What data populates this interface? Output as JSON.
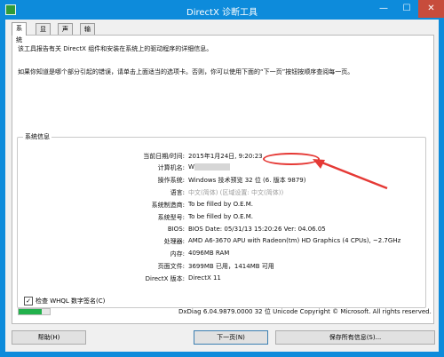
{
  "window": {
    "title": "DirectX 诊断工具",
    "min": "—",
    "max": "☐",
    "close": "✕"
  },
  "tabs": [
    {
      "label": "系统",
      "active": true
    },
    {
      "label": "显示",
      "active": false
    },
    {
      "label": "声音",
      "active": false
    },
    {
      "label": "输入",
      "active": false
    }
  ],
  "intro": {
    "line1": "该工具报告有关 DirectX 组件和安装在系统上的驱动程序的详细信息。",
    "line2": "如果你知道是哪个部分引起的错误，请单击上面适当的选项卡。否则，你可以使用下面的“下一页”按钮按顺序查阅每一页。"
  },
  "system_info": {
    "title": "系统信息",
    "rows": [
      {
        "label": "当前日期/时间:",
        "value": "2015年1月24日, 9:20:23"
      },
      {
        "label": "计算机名:",
        "value": "W"
      },
      {
        "label": "操作系统:",
        "value": "Windows 技术预览 32 位 (6.",
        "highlight": "版本 9879)"
      },
      {
        "label": "语言:",
        "value": "中文(简体) (区域设置: 中文(简体))"
      },
      {
        "label": "系统制造商:",
        "value": "To be filled by O.E.M."
      },
      {
        "label": "系统型号:",
        "value": "To be filled by O.E.M."
      },
      {
        "label": "BIOS:",
        "value": "BIOS Date: 05/31/13 15:20:26 Ver: 04.06.05"
      },
      {
        "label": "处理器:",
        "value": "AMD A6-3670 APU with Radeon(tm) HD Graphics (4 CPUs), ~2.7GHz"
      },
      {
        "label": "内存:",
        "value": "4096MB RAM"
      },
      {
        "label": "页面文件:",
        "value": "3699MB 已用，1414MB 可用"
      },
      {
        "label": "DirectX 版本:",
        "value": "DirectX 11"
      }
    ]
  },
  "whql": {
    "label": "检查 WHQL 数字签名(C)",
    "checked": true,
    "mark": "✓"
  },
  "progress": {
    "fraction": 0.75,
    "color": "#22b14c"
  },
  "footer_info": "DxDiag 6.04.9879.0000 32 位 Unicode  Copyright © Microsoft. All rights reserved.",
  "buttons": {
    "help": "帮助(H)",
    "next": "下一页(N)",
    "save": "保存所有信息(S)..."
  },
  "colors": {
    "titlebar": "#0d8bdb",
    "close": "#c74c3c",
    "callout": "#e53935"
  }
}
